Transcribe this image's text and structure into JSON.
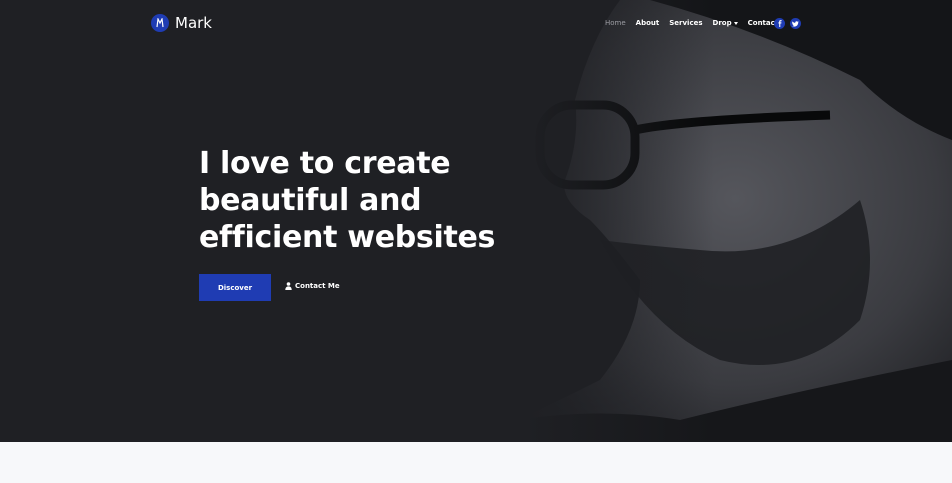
{
  "brand": {
    "name": "Mark",
    "logo_letter": "M"
  },
  "nav": {
    "items": [
      {
        "label": "Home",
        "active": true
      },
      {
        "label": "About"
      },
      {
        "label": "Services"
      },
      {
        "label": "Drop",
        "dropdown": true
      },
      {
        "label": "Contact"
      }
    ],
    "social": [
      "facebook-icon",
      "twitter-icon"
    ]
  },
  "hero": {
    "headline": [
      "I love to create",
      "beautiful and",
      "efficient websites"
    ],
    "primary_button": "Discover",
    "secondary_button": "Contact Me",
    "secondary_icon": "user-icon"
  },
  "colors": {
    "accent": "#1f3cb3",
    "hero_bg": "#1f2024",
    "page_bg": "#f7f8fa"
  }
}
